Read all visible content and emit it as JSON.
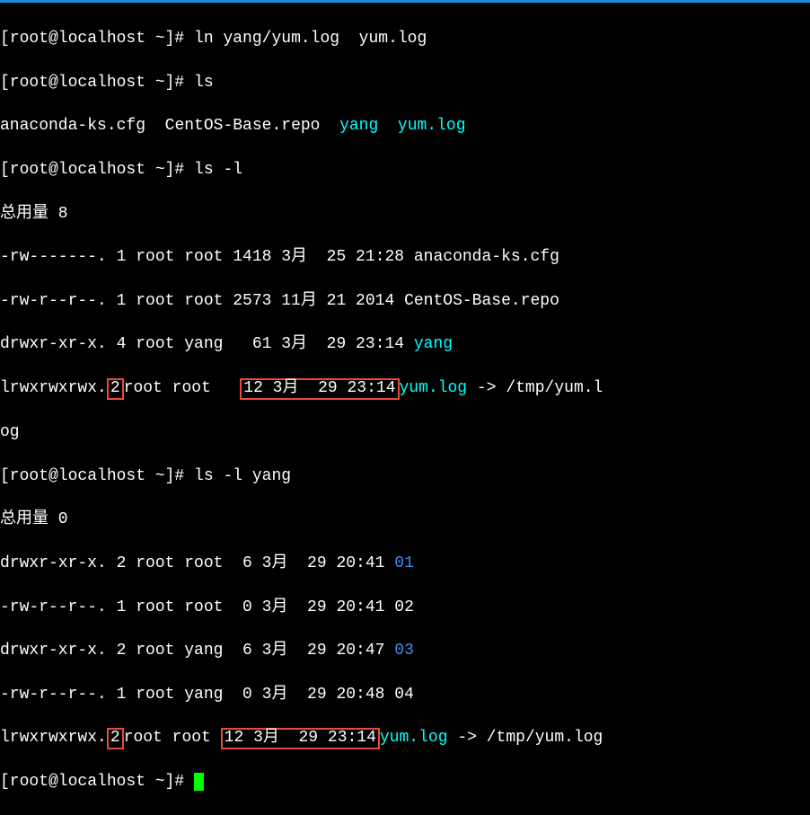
{
  "prompt": "[root@localhost ~]# ",
  "cmd1": "ln yang/yum.log  yum.log",
  "cmd2": "ls",
  "ls_out": {
    "f1": "anaconda-ks.cfg",
    "f2": "CentOS-Base.repo",
    "f3": "yang",
    "f4": "yum.log"
  },
  "cmd3": "ls -l",
  "total1": "总用量 8",
  "row1": "-rw-------. 1 root root 1418 3月  25 21:28 anaconda-ks.cfg",
  "row2": "-rw-r--r--. 1 root root 2573 11月 21 2014 CentOS-Base.repo",
  "row3a": "drwxr-xr-x. 4 root yang   61 3月  29 23:14 ",
  "row3b": "yang",
  "row4a": "lrwxrwxrwx.",
  "row4_links": "2",
  "row4b": "root root   ",
  "row4_mid": "12 3月  29 23:14",
  "row4c": "yum.log",
  "row4d": " -> /tmp/yum.l",
  "row4e": "og",
  "cmd4": "ls -l yang",
  "total2": "总用量 0",
  "y1a": "drwxr-xr-x. 2 root root  6 3月  29 20:41 ",
  "y1b": "01",
  "y2": "-rw-r--r--. 1 root root  0 3月  29 20:41 02",
  "y3a": "drwxr-xr-x. 2 root yang  6 3月  29 20:47 ",
  "y3b": "03",
  "y4": "-rw-r--r--. 1 root yang  0 3月  29 20:48 04",
  "y5a": "lrwxrwxrwx.",
  "y5_links": "2",
  "y5b": "root root ",
  "y5_mid": "12 3月  29 23:14",
  "y5c": "yum.log",
  "y5d": " -> /tmp/yum.log"
}
